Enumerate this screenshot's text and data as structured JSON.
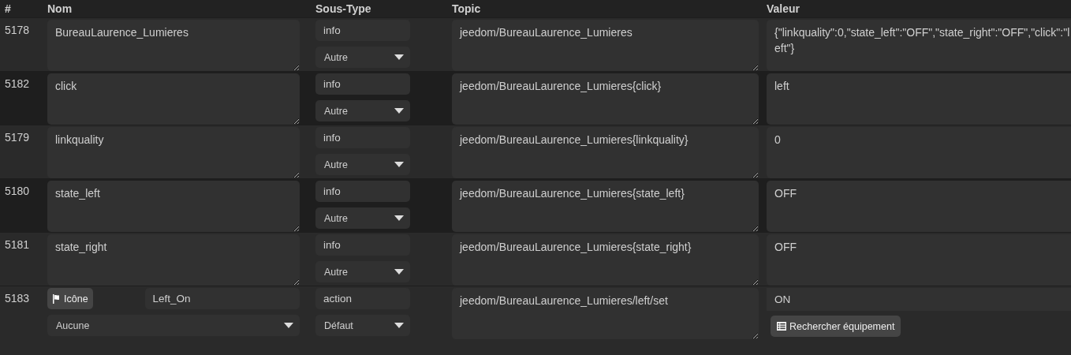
{
  "columns": [
    "#",
    "Nom",
    "Sous-Type",
    "Topic",
    "Valeur"
  ],
  "rows": [
    {
      "kind": "info",
      "id": "5178",
      "name": "BureauLaurence_Lumieres",
      "type": "info",
      "subtype": "Autre",
      "topic": "jeedom/BureauLaurence_Lumieres",
      "value": "{\"linkquality\":0,\"state_left\":\"OFF\",\"state_right\":\"OFF\",\"click\":\"left\"}"
    },
    {
      "kind": "info",
      "id": "5182",
      "name": "click",
      "type": "info",
      "subtype": "Autre",
      "topic": "jeedom/BureauLaurence_Lumieres{click}",
      "value": "left"
    },
    {
      "kind": "info",
      "id": "5179",
      "name": "linkquality",
      "type": "info",
      "subtype": "Autre",
      "topic": "jeedom/BureauLaurence_Lumieres{linkquality}",
      "value": "0"
    },
    {
      "kind": "info",
      "id": "5180",
      "name": "state_left",
      "type": "info",
      "subtype": "Autre",
      "topic": "jeedom/BureauLaurence_Lumieres{state_left}",
      "value": "OFF"
    },
    {
      "kind": "info",
      "id": "5181",
      "name": "state_right",
      "type": "info",
      "subtype": "Autre",
      "topic": "jeedom/BureauLaurence_Lumieres{state_right}",
      "value": "OFF"
    },
    {
      "kind": "action",
      "id": "5183",
      "icon_button": "Icône",
      "name": "Left_On",
      "icon_select": "Aucune",
      "type": "action",
      "subtype": "Défaut",
      "topic": "jeedom/BureauLaurence_Lumieres/left/set",
      "value": "ON",
      "search_button": "Rechercher équipement"
    }
  ]
}
